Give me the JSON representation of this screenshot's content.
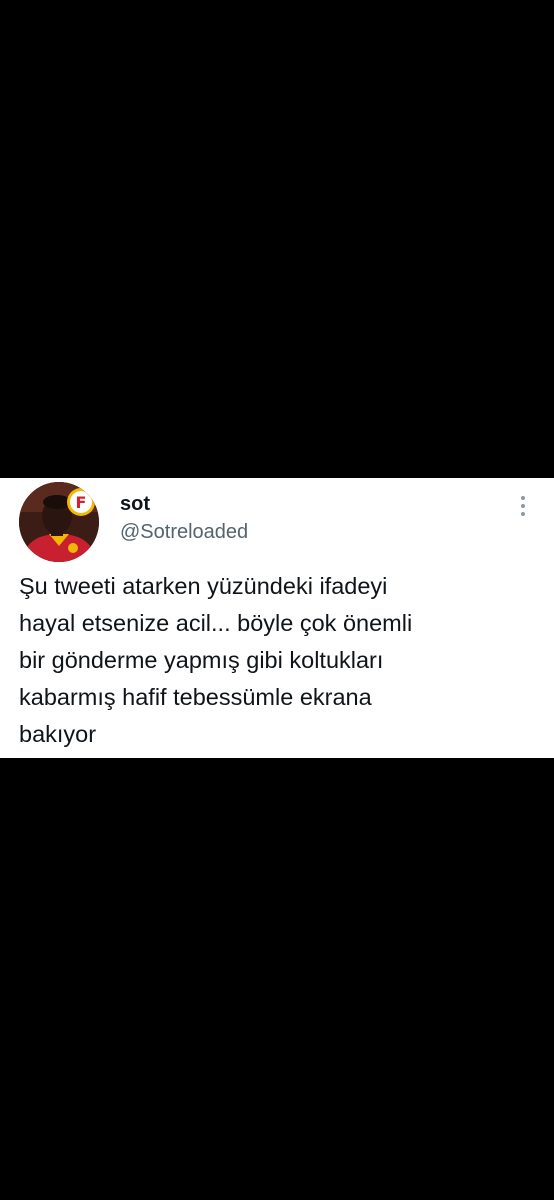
{
  "tweet": {
    "author": {
      "display_name": "sot",
      "handle": "@Sotreloaded",
      "avatar_badge_letter": "F"
    },
    "more_icon": "more-vertical-icon",
    "text_lines": [
      "Şu tweeti atarken yüzündeki ifadeyi",
      "hayal etsenize acil... böyle çok önemli",
      "bir gönderme yapmış gibi koltukları",
      "kabarmış hafif tebessümle ekrana",
      "bakıyor"
    ]
  },
  "colors": {
    "background": "#000000",
    "card": "#ffffff",
    "text_primary": "#0f1419",
    "text_secondary": "#536471",
    "avatar_badge": "#f5b800",
    "avatar_jersey": "#c8202f"
  }
}
